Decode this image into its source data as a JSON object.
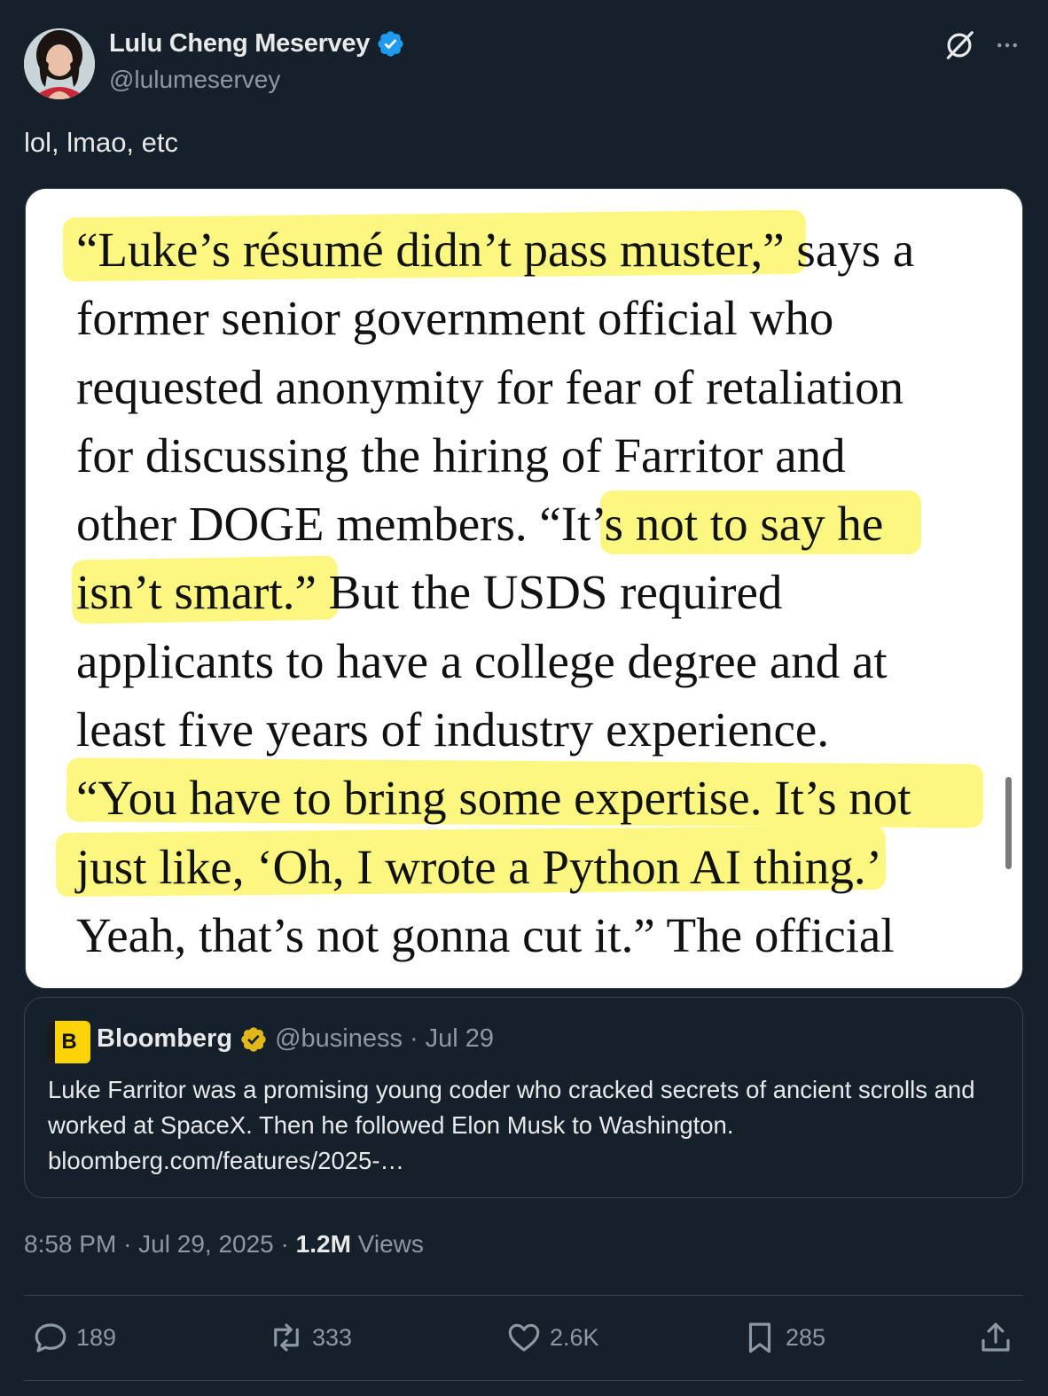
{
  "author": {
    "display_name": "Lulu Cheng Meservey",
    "handle": "@lulumeservey",
    "verified": true
  },
  "tweet": {
    "text": "lol, lmao, etc"
  },
  "media": {
    "lines": [
      "“Luke’s résumé didn’t pass muster,” says a",
      "former senior government official who",
      "requested anonymity for fear of retaliation",
      "for discussing the hiring of Farritor and",
      "other DOGE members. “It’s not to say he",
      "isn’t smart.” But the USDS required",
      "applicants to have a college degree and at",
      "least five years of industry experience.",
      "“You have to bring some expertise. It’s not",
      "just like, ‘Oh, I wrote a Python AI thing.’",
      "Yeah, that’s not gonna cut it.” The official"
    ],
    "highlight_color": "#fbf77a"
  },
  "quote": {
    "avatar_letter": "B",
    "name": "Bloomberg",
    "handle": "@business",
    "separator": "·",
    "date": "Jul 29",
    "text": "Luke Farritor was a promising young coder who cracked secrets of ancient scrolls and worked at SpaceX. Then he followed Elon Musk to Washington. bloomberg.com/features/2025-…"
  },
  "meta": {
    "time": "8:58 PM",
    "separator": "·",
    "date": "Jul 29, 2025",
    "views_count": "1.2M",
    "views_label": "Views"
  },
  "actions": {
    "replies": "189",
    "reposts": "333",
    "likes": "2.6K",
    "bookmarks": "285"
  },
  "icons": [
    "verified-badge-icon",
    "grok-icon",
    "more-icon",
    "reply-icon",
    "repost-icon",
    "like-icon",
    "bookmark-icon",
    "share-icon"
  ],
  "colors": {
    "background": "#15202b",
    "verified_blue": "#1d9bf0",
    "verified_gold": "#e2b719",
    "muted_text": "#8b98a5"
  }
}
